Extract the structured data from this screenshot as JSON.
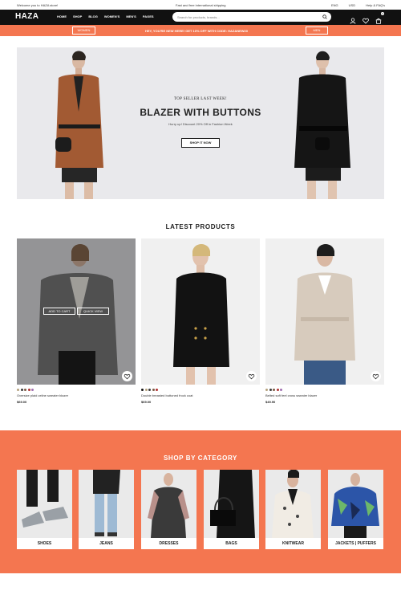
{
  "topbar": {
    "welcome": "Welcome you to HAZA store!",
    "shipping": "Fast and free international shipping",
    "lang": "ENG",
    "currency": "USD",
    "help": "Help & FAQ's"
  },
  "header": {
    "logo": "HAZA",
    "nav": [
      "HOME",
      "SHOP",
      "BLOG",
      "WOMEN'S",
      "MEN'S",
      "PAGES"
    ],
    "search_placeholder": "Search for products, brands...",
    "cart_count": "0"
  },
  "promo": {
    "women": "WOMEN",
    "text": "HEY, YOU'RE NEW HERE! GET 10% OFF WITH CODE: HAZANEW20",
    "men": "MEN"
  },
  "hero": {
    "subtitle": "TOP SELLER LAST WEEK!",
    "title": "BLAZER WITH BUTTONS",
    "desc": "Hurry up! Discount 20% Off in Fashion Week",
    "cta": "SHOP IT NOW"
  },
  "products": {
    "title": "LATEST PRODUCTS",
    "add_to_cart": "ADD TO CART",
    "quick_view": "QUICK VIEW",
    "items": [
      {
        "name": "Oversize plaid celine sweater blazer",
        "price": "$69.00",
        "swatches": [
          "#b4a07a",
          "#3a3a3a",
          "#7a5a44",
          "#b03030",
          "#a070b0"
        ]
      },
      {
        "name": "Double breasted buttoned frock coat",
        "price": "$69.00",
        "swatches": [
          "#111111",
          "#b4a07a",
          "#3a3a3a",
          "#7a5a44",
          "#b03030"
        ]
      },
      {
        "name": "Belted soft feel cross sweater blazer",
        "price": "$49.90",
        "swatches": [
          "#b4a07a",
          "#3a3a3a",
          "#7a5a44",
          "#b03030",
          "#a070b0"
        ]
      }
    ]
  },
  "categories": {
    "title": "SHOP BY CATEGORY",
    "items": [
      "SHOES",
      "JEANS",
      "DRESSES",
      "BAGS",
      "KNITWEAR",
      "JACKETS | PUFFERS"
    ]
  },
  "colors": {
    "accent": "#f47650",
    "dark": "#111111"
  }
}
